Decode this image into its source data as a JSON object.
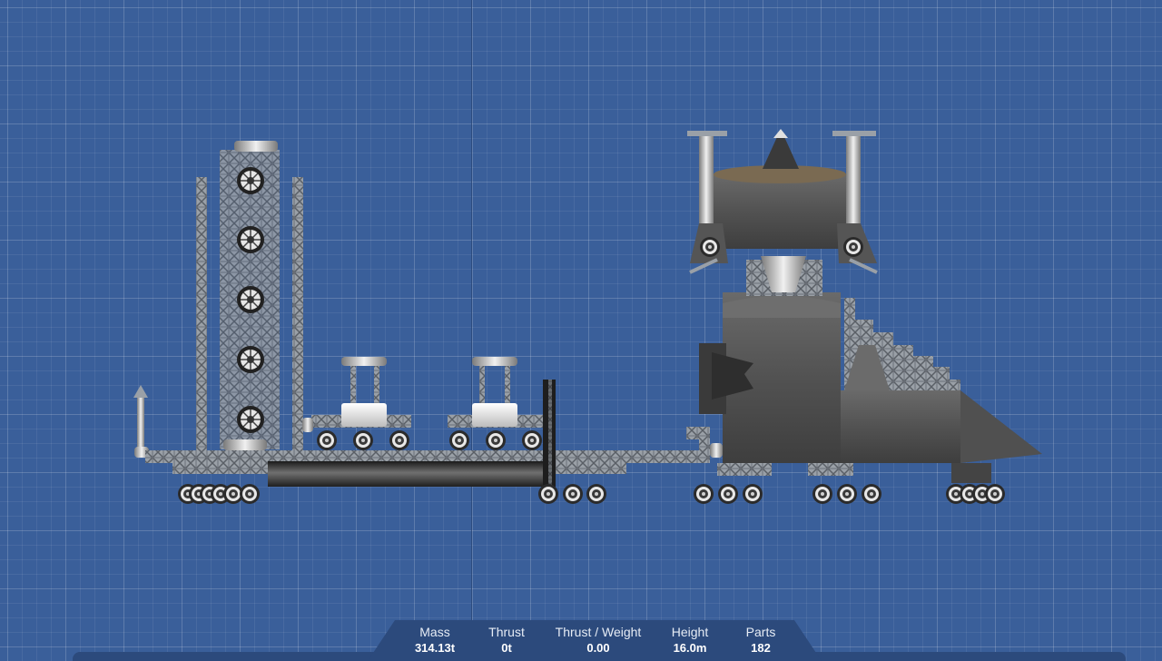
{
  "stats": [
    {
      "label": "Mass",
      "value": "314.13t"
    },
    {
      "label": "Thrust",
      "value": "0t"
    },
    {
      "label": "Thrust / Weight",
      "value": "0.00"
    },
    {
      "label": "Height",
      "value": "16.0m"
    },
    {
      "label": "Parts",
      "value": "182"
    }
  ],
  "colors": {
    "background": "#3a5f9a",
    "truss": "#8d9299",
    "hull": "#5c5c5c",
    "panel": "#2c4a7c"
  }
}
